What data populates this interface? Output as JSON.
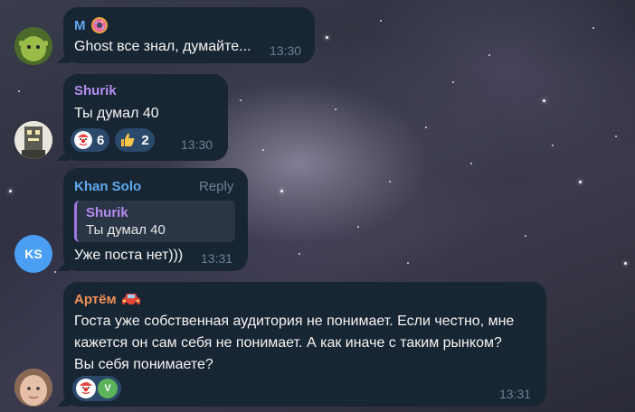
{
  "messages": [
    {
      "sender": "M",
      "sender_color": "#5fa9ee",
      "sender_badge": "donut-icon",
      "text": "Ghost все знал, думайте...",
      "time": "13:30",
      "avatar_icon": "shrek-avatar"
    },
    {
      "sender": "Shurik",
      "sender_color": "#b48df0",
      "text": "Ты думал 40",
      "time": "13:30",
      "avatar_icon": "robot-avatar",
      "reactions": [
        {
          "emoji": "clown-icon",
          "count": "6"
        },
        {
          "emoji": "thumbs-up-icon",
          "count": "2"
        }
      ]
    },
    {
      "sender": "Khan Solo",
      "sender_color": "#5fa9ee",
      "reply_label": "Reply",
      "quote": {
        "author": "Shurik",
        "text": "Ты думал 40"
      },
      "text": "Уже поста нет)))",
      "time": "13:31",
      "avatar_initials": "KS",
      "avatar_color": "#4a9ff5"
    },
    {
      "sender": "Артём",
      "sender_color": "#f09257",
      "sender_badge": "car-icon",
      "text_lines": [
        "Госта уже собственная аудитория не понимает. Если честно, мне",
        "кажется он сам себя не понимает. А как иначе с таким рынком?",
        "Вы себя понимаете?"
      ],
      "time": "13:31",
      "avatar_icon": "face-avatar",
      "reactor_initial": "V",
      "reactions_mini": [
        "clown-icon",
        "user-v-avatar"
      ]
    }
  ],
  "colors": {
    "bubble": "#182533",
    "time": "#6d8096",
    "reaction_bg": "#2b4a6b",
    "quote_bar": "#9e77e3"
  }
}
